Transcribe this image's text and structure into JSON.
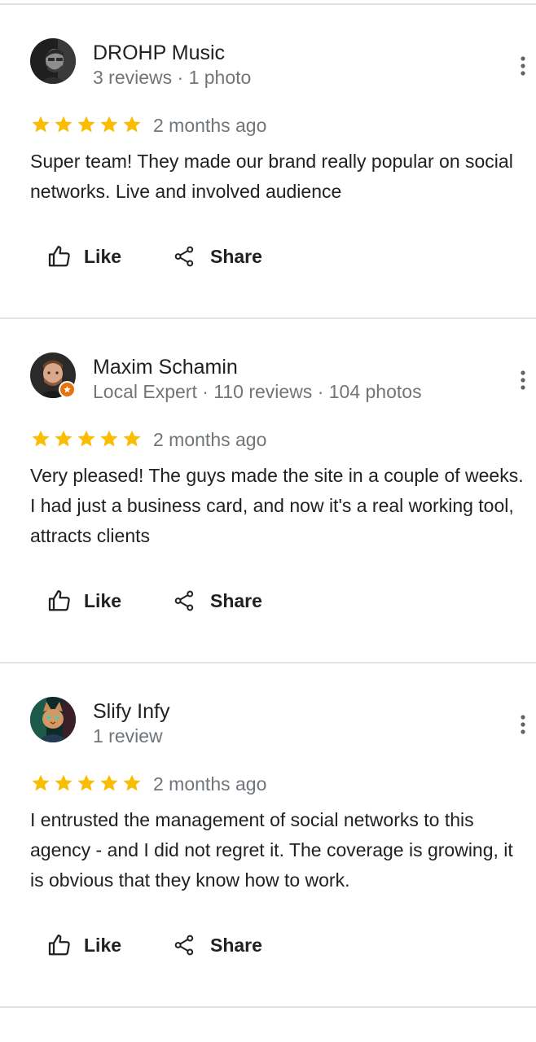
{
  "reviews": [
    {
      "name": "DROHP Music",
      "meta": "3 reviews · 1 photo",
      "rating": 5,
      "time": "2 months ago",
      "text": "Super team! They made our brand really popular on social networks. Live and involved audience",
      "like_label": "Like",
      "share_label": "Share",
      "local_expert": false
    },
    {
      "name": "Maxim Schamin",
      "meta": "Local Expert · 110 reviews · 104 photos",
      "rating": 5,
      "time": "2 months ago",
      "text": "Very pleased! The guys made the site in a couple of weeks. I had just a business card, and now it's a real working tool, attracts clients",
      "like_label": "Like",
      "share_label": "Share",
      "local_expert": true
    },
    {
      "name": "Slify Infy",
      "meta": "1 review",
      "rating": 5,
      "time": "2 months ago",
      "text": "I entrusted the management of social networks to this agency - and I did not regret it. The coverage is growing, it is obvious that they know how to work.",
      "like_label": "Like",
      "share_label": "Share",
      "local_expert": false
    }
  ],
  "colors": {
    "star": "#fbbc04",
    "secondary_text": "#70757a",
    "divider": "#e3e3e3",
    "badge": "#e8710a"
  },
  "icons": {
    "like": "thumb-up-outline-icon",
    "share": "share-icon",
    "more": "more-vert-icon",
    "star": "star-icon",
    "badge": "local-guide-badge-icon"
  }
}
